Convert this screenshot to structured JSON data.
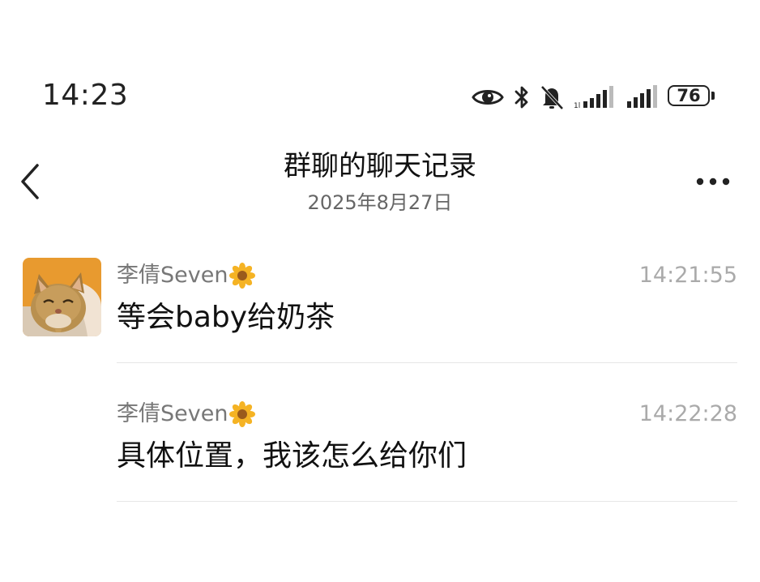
{
  "status_bar": {
    "time": "14:23",
    "battery": "76",
    "icons": [
      "eye-icon",
      "bluetooth-icon",
      "bell-muted-icon",
      "signal-icon",
      "signal-icon",
      "battery-icon"
    ]
  },
  "header": {
    "title": "群聊的聊天记录",
    "subtitle": "2025年8月27日",
    "back_icon": "chevron-left-icon",
    "more_icon": "more-dots-icon"
  },
  "messages": [
    {
      "sender": "李倩Seven",
      "sender_emoji": "sunflower-icon",
      "time": "14:21:55",
      "text": "等会baby给奶茶",
      "has_avatar": true
    },
    {
      "sender": "李倩Seven",
      "sender_emoji": "sunflower-icon",
      "time": "14:22:28",
      "text": "具体位置，我该怎么给你们",
      "has_avatar": false
    }
  ],
  "colors": {
    "background": "#ffffff",
    "text_primary": "#111111",
    "text_secondary": "#777777",
    "time_text": "#aaaaaa",
    "divider": "#e6e6e6"
  }
}
